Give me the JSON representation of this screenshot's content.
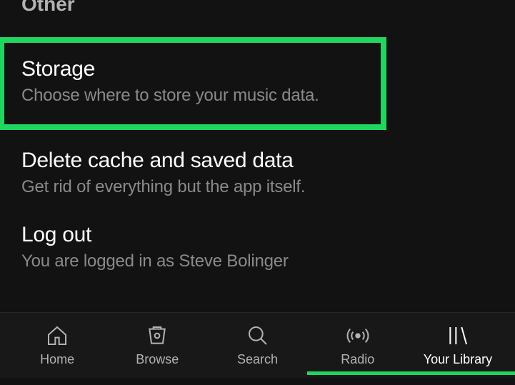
{
  "section_header": "Other",
  "settings": {
    "storage": {
      "title": "Storage",
      "desc": "Choose where to store your music data."
    },
    "delete_cache": {
      "title": "Delete cache and saved data",
      "desc": "Get rid of everything but the app itself."
    },
    "logout": {
      "title": "Log out",
      "desc": "You are logged in as Steve Bolinger"
    }
  },
  "nav": {
    "home": "Home",
    "browse": "Browse",
    "search": "Search",
    "radio": "Radio",
    "library": "Your Library"
  }
}
